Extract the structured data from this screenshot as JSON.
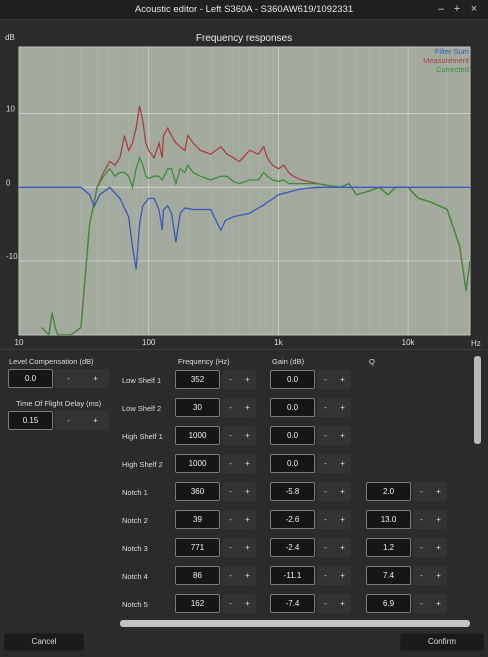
{
  "window": {
    "title": "Acoustic editor - Left S360A - S360AW619/1092331",
    "minimize": "–",
    "maximize": "+",
    "close": "×"
  },
  "chart_data": {
    "type": "line",
    "title": "Frequency responses",
    "ylabel": "dB",
    "xunit": "Hz",
    "xscale": "log",
    "xlim": [
      10,
      30000
    ],
    "ylim": [
      -20,
      19
    ],
    "x_ticks": [
      10,
      100,
      1000,
      10000
    ],
    "x_tick_labels": [
      "10",
      "100",
      "1k",
      "10k"
    ],
    "y_ticks": [
      10,
      0,
      -10
    ],
    "y_tick_labels": [
      "10",
      "0",
      "-10"
    ],
    "grid": true,
    "legend_position": "top-right",
    "series": [
      {
        "name": "Filter Sum",
        "color": "#3a57c0",
        "x": [
          10,
          30,
          35,
          38,
          42,
          50,
          60,
          70,
          75,
          80,
          85,
          90,
          100,
          110,
          120,
          127,
          130,
          140,
          150,
          162,
          175,
          190,
          220,
          300,
          330,
          360,
          390,
          450,
          600,
          771,
          820,
          900,
          1000,
          1500,
          2000,
          3000,
          5000,
          10000,
          30000
        ],
        "y": [
          0,
          0,
          -1,
          -2.6,
          -1,
          0,
          -1.5,
          -4,
          -8,
          -11.1,
          -5,
          -2.5,
          -1.5,
          -1.5,
          -3,
          -5.8,
          -3,
          -2.5,
          -3.5,
          -7.4,
          -3.5,
          -2.8,
          -3,
          -3,
          -4.5,
          -5.8,
          -4.5,
          -4,
          -3.5,
          -2.4,
          -2,
          -1.6,
          -1,
          -0.2,
          0,
          0,
          0,
          0,
          0
        ]
      },
      {
        "name": "Measurement",
        "color": "#a84040",
        "x": [
          15,
          17,
          18,
          19,
          20,
          22,
          25,
          30,
          35,
          38,
          40,
          45,
          50,
          55,
          60,
          65,
          70,
          75,
          80,
          85,
          90,
          95,
          100,
          110,
          120,
          127,
          130,
          140,
          150,
          162,
          175,
          190,
          200,
          220,
          250,
          300,
          360,
          400,
          450,
          500,
          600,
          700,
          771,
          820,
          900,
          1000,
          1100,
          1200,
          1300,
          1500,
          2000,
          2500,
          3000,
          3500,
          4000,
          5000,
          6000,
          7000,
          8000,
          10000,
          12000,
          15000,
          20000,
          25000,
          28000,
          30000
        ],
        "y": [
          -19,
          -20,
          -17,
          -19,
          -20,
          -20,
          -20,
          -19,
          -5,
          -2,
          0,
          2,
          3.5,
          3,
          4,
          7,
          5,
          6,
          8,
          11,
          9,
          6,
          5,
          4,
          6,
          4,
          7,
          8,
          7,
          6,
          5.5,
          5,
          7,
          6,
          5,
          4.5,
          5.5,
          4.5,
          4,
          3.5,
          5,
          4.5,
          5.5,
          4,
          3,
          2.5,
          3,
          2,
          1.5,
          1,
          0.5,
          0.2,
          0,
          0.5,
          -1,
          -0.5,
          0,
          -1,
          0,
          0,
          -1.5,
          -2,
          -3,
          -8,
          -14,
          -10
        ]
      },
      {
        "name": "Corrected",
        "color": "#3f8a3f",
        "x": [
          15,
          17,
          18,
          19,
          20,
          22,
          25,
          30,
          35,
          38,
          40,
          45,
          50,
          55,
          60,
          65,
          70,
          75,
          80,
          85,
          90,
          95,
          100,
          110,
          120,
          127,
          130,
          140,
          150,
          162,
          175,
          190,
          200,
          220,
          250,
          300,
          360,
          400,
          450,
          500,
          600,
          700,
          771,
          820,
          900,
          1000,
          1100,
          1200,
          1300,
          1500,
          2000,
          2500,
          3000,
          3500,
          4000,
          5000,
          6000,
          7000,
          8000,
          10000,
          12000,
          15000,
          20000,
          25000,
          28000,
          30000
        ],
        "y": [
          -19,
          -20,
          -17,
          -19,
          -20,
          -20,
          -20,
          -19,
          -5,
          -2,
          0,
          1.5,
          2.5,
          1.5,
          2,
          2,
          1.5,
          0,
          2.5,
          4,
          3,
          1.5,
          1.2,
          1.5,
          1.5,
          1,
          1.3,
          2.5,
          2.5,
          0.5,
          2.5,
          2,
          3,
          2,
          1.5,
          1,
          1.5,
          1.5,
          0.8,
          0.5,
          1,
          1,
          2,
          1.5,
          1,
          0.8,
          1,
          0.5,
          0.5,
          0.5,
          0.5,
          0.2,
          0,
          0.5,
          -1,
          -0.5,
          0,
          -1,
          0,
          0,
          -1.5,
          -2,
          -3,
          -8,
          -14,
          -10
        ]
      }
    ]
  },
  "controls": {
    "level_compensation": {
      "label": "Level Compensation (dB)",
      "value": "0.0"
    },
    "time_of_flight": {
      "label": "Time Of Flight Delay (ms)",
      "value": "0.15"
    },
    "minus": "-",
    "plus": "+"
  },
  "filters": {
    "headers": {
      "frequency": "Frequency (Hz)",
      "gain": "Gain (dB)",
      "q": "Q"
    },
    "rows": [
      {
        "name": "Low Shelf 1",
        "frequency": "352",
        "gain": "0.0",
        "q": ""
      },
      {
        "name": "Low Shelf 2",
        "frequency": "30",
        "gain": "0.0",
        "q": ""
      },
      {
        "name": "High Shelf 1",
        "frequency": "1000",
        "gain": "0.0",
        "q": ""
      },
      {
        "name": "High Shelf 2",
        "frequency": "1000",
        "gain": "0.0",
        "q": ""
      },
      {
        "name": "Notch 1",
        "frequency": "360",
        "gain": "-5.8",
        "q": "2.0"
      },
      {
        "name": "Notch 2",
        "frequency": "39",
        "gain": "-2.6",
        "q": "13.0"
      },
      {
        "name": "Notch 3",
        "frequency": "771",
        "gain": "-2.4",
        "q": "1.2"
      },
      {
        "name": "Notch 4",
        "frequency": "86",
        "gain": "-11.1",
        "q": "7.4"
      },
      {
        "name": "Notch 5",
        "frequency": "162",
        "gain": "-7.4",
        "q": "6.9"
      }
    ]
  },
  "buttons": {
    "cancel": "Cancel",
    "confirm": "Confirm"
  }
}
